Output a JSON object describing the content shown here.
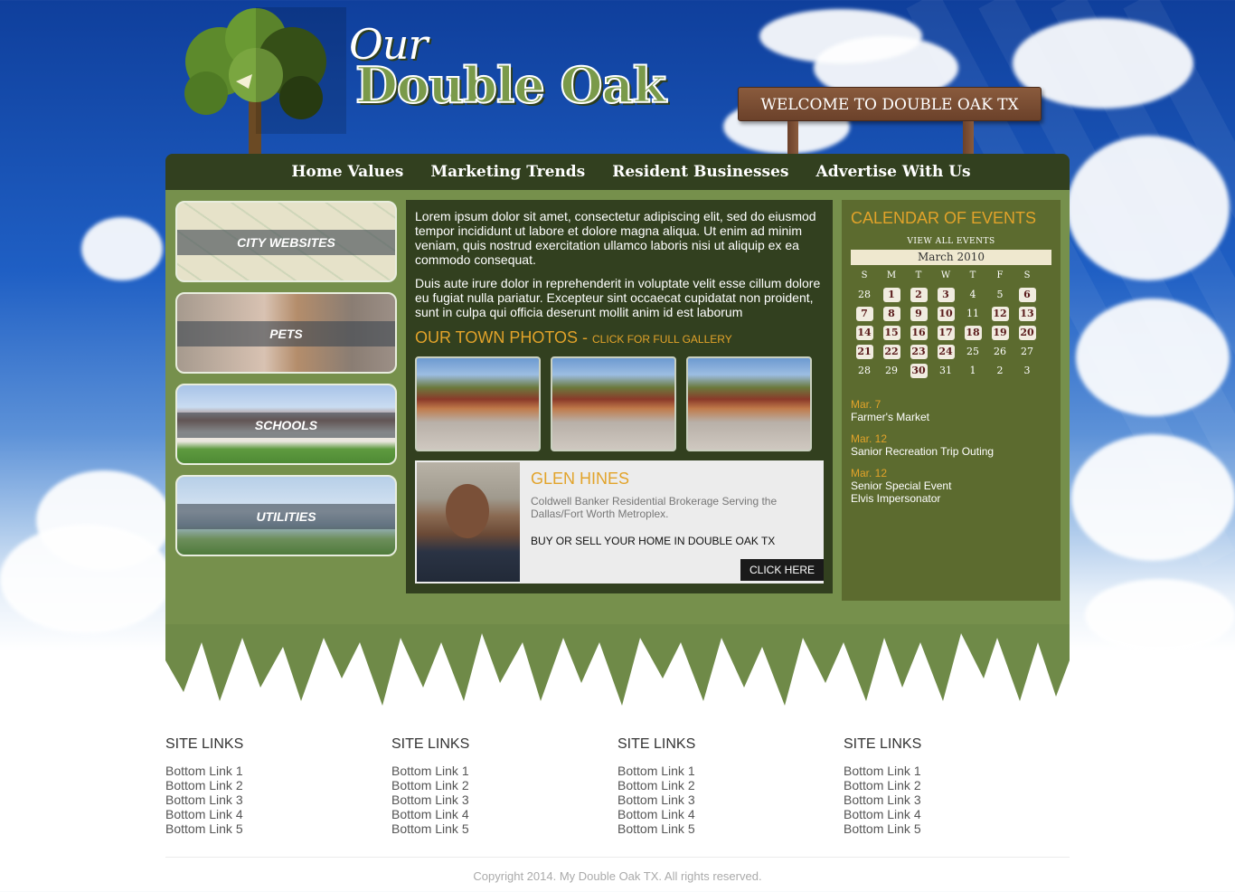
{
  "site": {
    "logo_small": "Our",
    "logo_main": "Double Oak",
    "welcome_sign": "WELCOME TO DOUBLE OAK TX"
  },
  "nav": {
    "items": [
      {
        "label": "Home Values"
      },
      {
        "label": "Marketing Trends"
      },
      {
        "label": "Resident Businesses"
      },
      {
        "label": "Advertise With Us"
      }
    ]
  },
  "sidebar": {
    "tiles": [
      {
        "label": "CITY WEBSITES"
      },
      {
        "label": "PETS"
      },
      {
        "label": "SCHOOLS"
      },
      {
        "label": "UTILITIES"
      }
    ]
  },
  "content": {
    "paragraph1": "Lorem ipsum dolor sit amet, consectetur adipiscing elit, sed do eiusmod tempor incididunt ut labore et dolore magna aliqua. Ut enim ad minim veniam, quis nostrud exercitation ullamco laboris nisi ut aliquip ex ea commodo consequat.",
    "paragraph2": "Duis aute irure dolor in reprehenderit in voluptate velit esse cillum dolore eu fugiat nulla pariatur. Excepteur sint occaecat cupidatat non proident, sunt in culpa qui officia deserunt mollit anim id est laborum",
    "photos_heading": "OUR TOWN PHOTOS - ",
    "photos_link": "CLICK FOR FULL GALLERY"
  },
  "agent": {
    "name": "GLEN HINES",
    "description": "Coldwell Banker Residential Brokerage Serving the Dallas/Fort Worth Metroplex.",
    "cta": "BUY OR SELL YOUR HOME IN DOUBLE OAK TX",
    "button": "CLICK HERE"
  },
  "calendar": {
    "title": "CALENDAR OF EVENTS",
    "view_all": "VIEW ALL EVENTS",
    "month": "March 2010",
    "dow": [
      "S",
      "M",
      "T",
      "W",
      "T",
      "F",
      "S"
    ],
    "weeks": [
      [
        {
          "d": "28",
          "e": false
        },
        {
          "d": "1",
          "e": true
        },
        {
          "d": "2",
          "e": true
        },
        {
          "d": "3",
          "e": true
        },
        {
          "d": "4",
          "e": false
        },
        {
          "d": "5",
          "e": false
        },
        {
          "d": "6",
          "e": true
        }
      ],
      [
        {
          "d": "7",
          "e": true
        },
        {
          "d": "8",
          "e": true
        },
        {
          "d": "9",
          "e": true
        },
        {
          "d": "10",
          "e": true
        },
        {
          "d": "11",
          "e": false
        },
        {
          "d": "12",
          "e": true
        },
        {
          "d": "13",
          "e": true
        }
      ],
      [
        {
          "d": "14",
          "e": true
        },
        {
          "d": "15",
          "e": true
        },
        {
          "d": "16",
          "e": true
        },
        {
          "d": "17",
          "e": true
        },
        {
          "d": "18",
          "e": true
        },
        {
          "d": "19",
          "e": true
        },
        {
          "d": "20",
          "e": true
        }
      ],
      [
        {
          "d": "21",
          "e": true
        },
        {
          "d": "22",
          "e": true
        },
        {
          "d": "23",
          "e": true
        },
        {
          "d": "24",
          "e": true
        },
        {
          "d": "25",
          "e": false
        },
        {
          "d": "26",
          "e": false
        },
        {
          "d": "27",
          "e": false
        }
      ],
      [
        {
          "d": "28",
          "e": false
        },
        {
          "d": "29",
          "e": false
        },
        {
          "d": "30",
          "e": true
        },
        {
          "d": "31",
          "e": false
        },
        {
          "d": "1",
          "e": false
        },
        {
          "d": "2",
          "e": false
        },
        {
          "d": "3",
          "e": false
        }
      ]
    ],
    "events": [
      {
        "date": "Mar. 7",
        "lines": [
          "Farmer's Market"
        ]
      },
      {
        "date": "Mar. 12",
        "lines": [
          "Sanior Recreation Trip Outing"
        ]
      },
      {
        "date": "Mar. 12",
        "lines": [
          "Senior Special Event",
          "Elvis Impersonator"
        ]
      }
    ]
  },
  "footer": {
    "columns": [
      {
        "heading": "SITE LINKS",
        "links": [
          "Bottom Link 1",
          "Bottom Link 2",
          "Bottom Link 3",
          "Bottom Link 4",
          "Bottom Link 5"
        ]
      },
      {
        "heading": "SITE LINKS",
        "links": [
          "Bottom Link 1",
          "Bottom Link 2",
          "Bottom Link 3",
          "Bottom Link 4",
          "Bottom Link 5"
        ]
      },
      {
        "heading": "SITE LINKS",
        "links": [
          "Bottom Link 1",
          "Bottom Link 2",
          "Bottom Link 3",
          "Bottom Link 4",
          "Bottom Link 5"
        ]
      },
      {
        "heading": "SITE LINKS",
        "links": [
          "Bottom Link 1",
          "Bottom Link 2",
          "Bottom Link 3",
          "Bottom Link 4",
          "Bottom Link 5"
        ]
      }
    ],
    "copyright": "Copyright 2014. My Double Oak TX. All rights reserved."
  },
  "colors": {
    "accent_gold": "#e2a32a",
    "nav_dark_green": "#32401f",
    "main_green": "#76904c",
    "calendar_green": "#5c6b2f"
  }
}
